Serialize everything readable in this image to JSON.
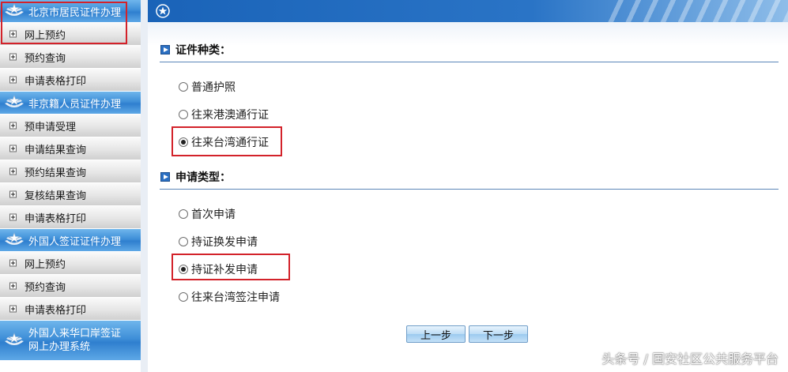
{
  "sidebar": {
    "sections": [
      {
        "title": "北京市居民证件办理",
        "items": [
          "网上预约",
          "预约查询",
          "申请表格打印"
        ]
      },
      {
        "title": "非京籍人员证件办理",
        "items": [
          "预申请受理",
          "申请结果查询",
          "预约结果查询",
          "复核结果查询",
          "申请表格打印"
        ]
      },
      {
        "title": "外国人签证证件办理",
        "items": [
          "网上预约",
          "预约查询",
          "申请表格打印"
        ]
      },
      {
        "title": "外国人来华口岸签证\n网上办理系统",
        "items": []
      }
    ]
  },
  "main": {
    "doc_type": {
      "title": "证件种类：",
      "options": [
        {
          "label": "普通护照",
          "selected": false
        },
        {
          "label": "往来港澳通行证",
          "selected": false
        },
        {
          "label": "往来台湾通行证",
          "selected": true
        }
      ]
    },
    "apply_type": {
      "title": "申请类型：",
      "options": [
        {
          "label": "首次申请",
          "selected": false
        },
        {
          "label": "持证换发申请",
          "selected": false
        },
        {
          "label": "持证补发申请",
          "selected": true
        },
        {
          "label": "往来台湾签注申请",
          "selected": false
        }
      ]
    },
    "buttons": {
      "prev": "上一步",
      "next": "下一步"
    }
  },
  "watermark": "头条号 / 国安社区公共服务平台",
  "colors": {
    "header_blue": "#2f7fcf",
    "highlight_red": "#d3222a",
    "divider_blue": "#5b86b8"
  }
}
